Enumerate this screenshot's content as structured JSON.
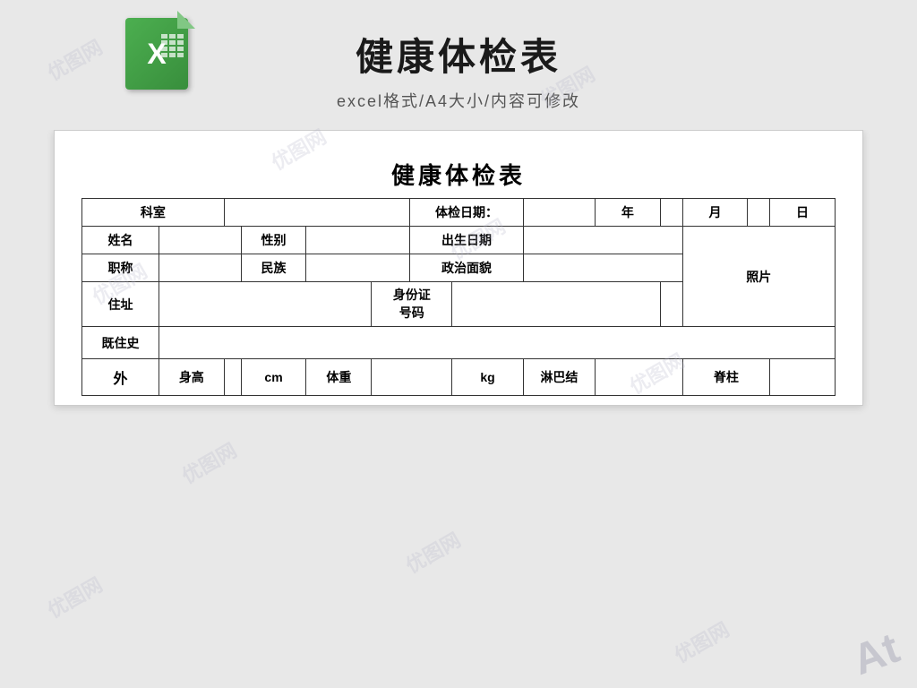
{
  "page": {
    "bg_color": "#e8e8e8",
    "watermark_text": "优图网"
  },
  "header": {
    "main_title": "健康体检表",
    "sub_title": "excel格式/A4大小/内容可修改",
    "excel_icon_letter": "X"
  },
  "document": {
    "title": "健康体检表",
    "fields": {
      "department_label": "科室",
      "exam_date_label": "体检日期：",
      "year_label": "年",
      "month_label": "月",
      "day_label": "日",
      "name_label": "姓名",
      "gender_label": "性别",
      "birth_label": "出生日期",
      "title_label": "职称",
      "ethnicity_label": "民族",
      "political_label": "政治面貌",
      "photo_label": "照片",
      "address_label": "住址",
      "id_label": "身份证号码",
      "history_label": "既住史",
      "height_label": "身高",
      "height_unit": "cm",
      "weight_label": "体重",
      "weight_unit": "kg",
      "lymph_label": "淋巴结",
      "spine_label": "脊柱",
      "external_label": "外"
    }
  }
}
